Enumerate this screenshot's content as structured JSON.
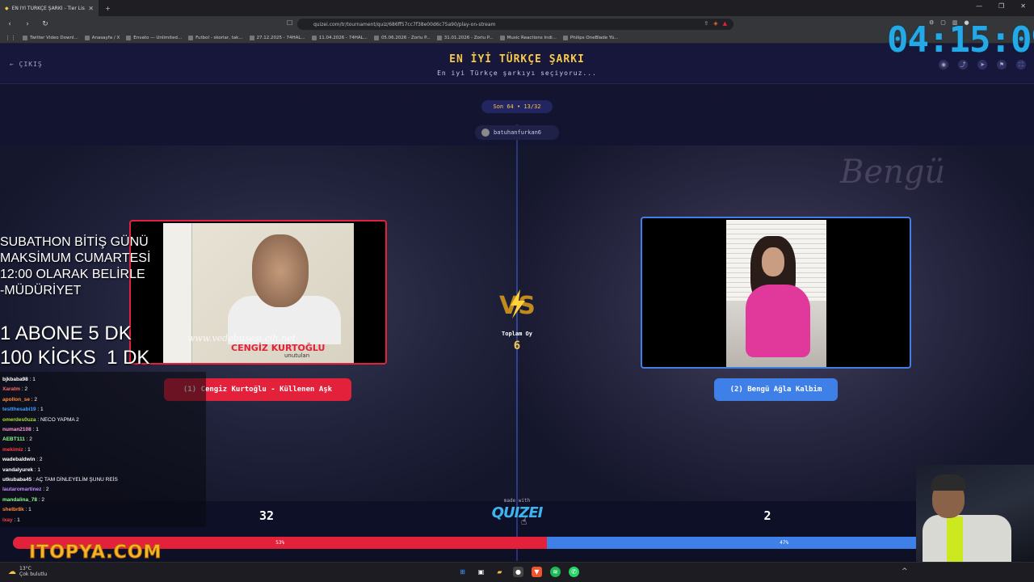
{
  "browser": {
    "tab_title": "EN İYİ TÜRKÇE ŞARKI - Tier List,",
    "url": "quizei.com/tr/tournament/quiz/686ff57cc7f38e00d6c75a90/play-on-stream",
    "bookmarks": [
      "Twitter Video Downl...",
      "Anasayfa / X",
      "Envato — Unlimited...",
      "Futbol - skorlar, tak...",
      "27.12.2025 - 74HAL...",
      "11.04.2026 - 74HAL...",
      "05.06.2026 - Zorlu P...",
      "31.01.2026 - Zorlu P...",
      "Music Reactions Indi...",
      "Philips OneBlade Yü..."
    ]
  },
  "clock": "04:15:09",
  "quiz": {
    "exit_label": "ÇIKIŞ",
    "title": "EN İYİ TÜRKÇE ŞARKI",
    "subtitle": "En iyi Türkçe şarkıyı seçiyoruz...",
    "round": "Son 64 • 13/32",
    "user": "batuhanfurkan6",
    "vs": "VS",
    "total_label": "Toplam Oy",
    "total_value": "6",
    "left": {
      "label": "(1) Cengiz Kurtoğlu - Küllenen Aşk",
      "cover_name": "CENGİZ KURTOĞLU",
      "cover_album": "unutulan",
      "cover_watermark": "www.vedabusesi.cih.net",
      "score": "32",
      "percent_label": "53%",
      "percent": 53
    },
    "right": {
      "label": "(2) Bengü Ağla Kalbim",
      "bg_text": "Bengü",
      "score": "2",
      "percent_label": "47%",
      "percent": 47
    },
    "made_with": "made with",
    "logo": "QUIZEI"
  },
  "overlay": {
    "subathon": "SUBATHON BİTİŞ GÜNÜ\nMAKSİMUM CUMARTESİ\n12:00 OLARAK BELİRLE\n-MÜDÜRİYET",
    "abone": "1 ABONE 5 DK\n100 KİCKS  1 DK",
    "sponsor": "ITOPYA.COM"
  },
  "chat": [
    {
      "user": "bjkbaba98",
      "msg": ": 1",
      "color": "#ffffff"
    },
    {
      "user": "Xaratm",
      "msg": ": 2",
      "color": "#ff6b6b"
    },
    {
      "user": "apollon_se",
      "msg": ": 2",
      "color": "#ff8c3a"
    },
    {
      "user": "testthesabi19",
      "msg": ": 1",
      "color": "#3fa0ff"
    },
    {
      "user": "omerdes0uza",
      "msg": ": NECO YAPMA 2",
      "color": "#a6e22e"
    },
    {
      "user": "numan2108",
      "msg": ": 1",
      "color": "#ff9ad5"
    },
    {
      "user": "AEBT111",
      "msg": ": 2",
      "color": "#8bff8b"
    },
    {
      "user": "mekimiz",
      "msg": ": 1",
      "color": "#ff4040"
    },
    {
      "user": "wadebaldwin",
      "msg": ": 2",
      "color": "#ffffff"
    },
    {
      "user": "vandalyurek",
      "msg": ": 1",
      "color": "#ffffff"
    },
    {
      "user": "utkubaba45",
      "msg": ": AÇ TAM DİNLEYELİM ŞUNU REİS",
      "color": "#ffffff"
    },
    {
      "user": "lautaromartinez",
      "msg": ": 2",
      "color": "#c48bff"
    },
    {
      "user": "mandalina_78",
      "msg": ": 2",
      "color": "#8bff8b"
    },
    {
      "user": "shelbr8k",
      "msg": ": 1",
      "color": "#ff8c3a"
    },
    {
      "user": "ixay",
      "msg": ": 1",
      "color": "#ff4040"
    }
  ],
  "taskbar": {
    "temp": "13°C",
    "weather": "Çok bulutlu"
  },
  "colors": {
    "left_accent": "#e3213a",
    "right_accent": "#3f7fe8",
    "title_yellow": "#f7c948",
    "clock_blue": "#24a8e6"
  }
}
